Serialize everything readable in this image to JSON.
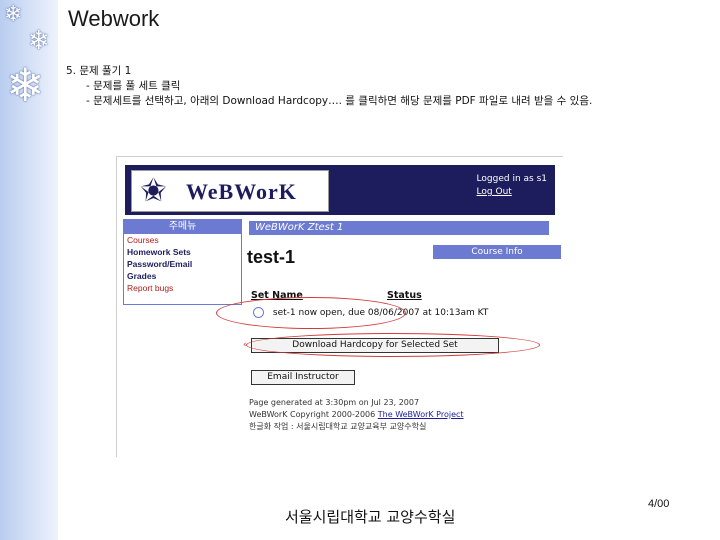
{
  "slide": {
    "title": "Webwork",
    "bullet_main": "5. 문제 풀기 1",
    "bullet_sub1": "- 문제를 풀 세트 클릭",
    "bullet_sub2": "- 문제세트를 선택하고, 아래의 Download Hardcopy…. 를 클릭하면 해당 문제를 PDF 파일로 내려 받을 수 있음.",
    "caption": "서울시립대학교 교양수학실",
    "page_number": "4/00"
  },
  "screenshot": {
    "logo_star": "✬",
    "logo_text": "WeBWorK",
    "login_text": "Logged in as s1",
    "logout_link": "Log Out",
    "menu": {
      "header": "주메뉴",
      "items": [
        "Courses",
        "Homework Sets",
        "Password/Email",
        "Grades"
      ],
      "report_bugs": "Report bugs"
    },
    "breadcrumb": "WeBWorK Ztest 1",
    "course_title": "test-1",
    "course_info": "Course Info",
    "table": {
      "col_set": "Set Name",
      "col_status": "Status",
      "row_set": "set-1",
      "row_status": "now open, due 08/06/2007 at 10:13am KT"
    },
    "download_button": "Download Hardcopy for Selected Set",
    "email_button": "Email Instructor",
    "footer_generated": "Page generated at 3:30pm on Jul 23, 2007",
    "footer_copyright": "WeBWorK Copyright 2000-2006",
    "footer_project_link": "The WeBWorK Project",
    "footer_local": "한글화 작업 : 서울시립대학교 교양교육부 교양수학실"
  },
  "colors": {
    "banner": "#1d1d5e",
    "accent": "#6c7bd1",
    "highlight_ellipse": "#d43a3a"
  }
}
